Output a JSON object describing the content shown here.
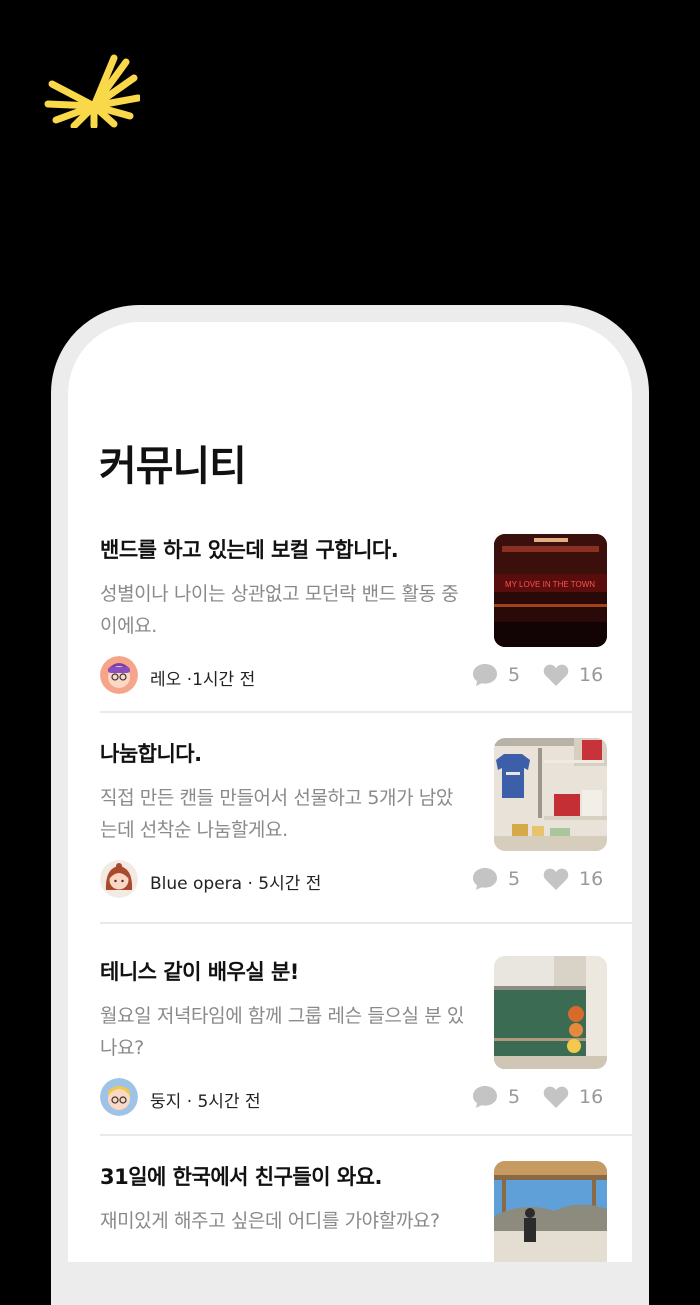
{
  "header": {
    "title": "커뮤니티"
  },
  "posts": [
    {
      "title": "밴드를 하고 있는데 보컬 구합니다.",
      "body": "성별이나 나이는 상관없고 모던락 밴드 활동 중이에요.",
      "author": "레오",
      "time": "·1시간 전",
      "comments": "5",
      "likes": "16",
      "thumb_text": "MY LOVE IN THE TOWN"
    },
    {
      "title": "나눔합니다.",
      "body": "직접 만든 캔들 만들어서 선물하고 5개가 남았는데 선착순 나눔할게요.",
      "author": "Blue opera",
      "time": "· 5시간 전",
      "comments": "5",
      "likes": "16"
    },
    {
      "title": "테니스 같이 배우실 분!",
      "body": "월요일 저녁타임에 함께 그룹 레슨 들으실 분 있나요?",
      "author": "둥지",
      "time": "· 5시간 전",
      "comments": "5",
      "likes": "16"
    },
    {
      "title": "31일에 한국에서 친구들이 와요.",
      "body": "재미있게 해주고 싶은데 어디를 가야할까요?"
    }
  ],
  "colors": {
    "accent": "#f9d84a",
    "background": "#000000",
    "frame": "#ececec"
  }
}
